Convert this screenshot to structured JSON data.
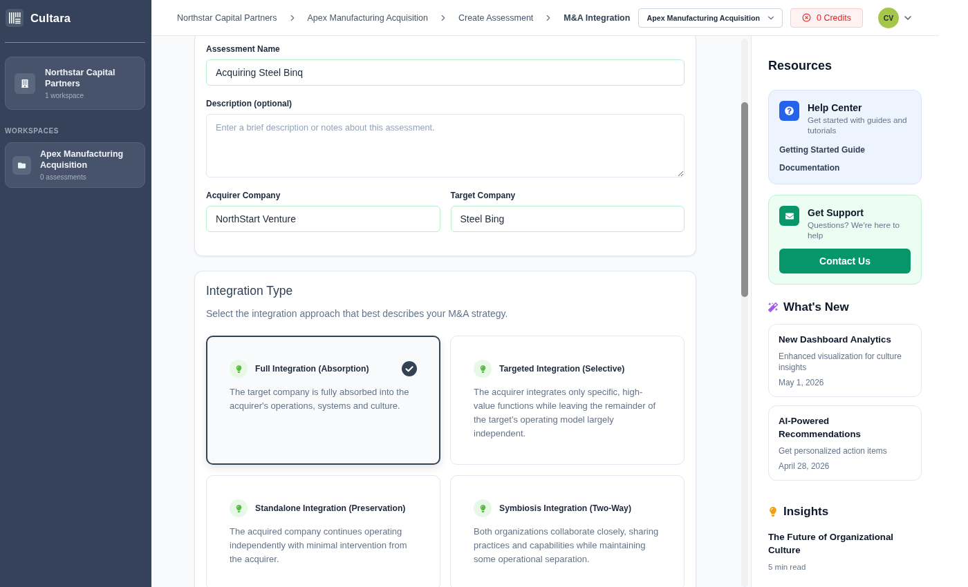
{
  "sidebar": {
    "brand": "Cultara",
    "organization": {
      "name": "Northstar Capital Partners",
      "meta": "1 workspace"
    },
    "section_label": "WORKSPACES",
    "workspaces": [
      {
        "name": "Apex Manufacturing Acquisition",
        "meta": "0 assessments"
      }
    ]
  },
  "header": {
    "breadcrumbs": [
      {
        "label": "Northstar Capital Partners",
        "current": false
      },
      {
        "label": "Apex Manufacturing Acquisition",
        "current": false
      },
      {
        "label": "Create Assessment",
        "current": false
      },
      {
        "label": "M&A Integration",
        "current": true
      }
    ],
    "workspace_select": {
      "value": "Apex Manufacturing Acquisition"
    },
    "credits": {
      "label": "0 Credits"
    },
    "avatar": {
      "initials": "CV"
    }
  },
  "details": {
    "assessment_name": {
      "label": "Assessment Name",
      "value": "Acquiring Steel Binq",
      "valid": true
    },
    "description": {
      "label": "Description (optional)",
      "placeholder": "Enter a brief description or notes about this assessment."
    },
    "companies": [
      {
        "label": "Acquirer Company",
        "value": "NorthStart Venture",
        "valid": true
      },
      {
        "label": "Target Company",
        "value": "Steel Bing",
        "valid": true
      }
    ]
  },
  "integration": {
    "title": "Integration Type",
    "subtitle": "Select the integration approach that best describes your M&A strategy.",
    "options": [
      {
        "title": "Full Integration (Absorption)",
        "description": "The target company is fully absorbed into the acquirer's operations, systems and culture.",
        "selected": true
      },
      {
        "title": "Targeted Integration (Selective)",
        "description": "The acquirer integrates only specific, high-value functions while leaving the remainder of the target's operating model largely independent.",
        "selected": false
      },
      {
        "title": "Standalone Integration (Preservation)",
        "description": "The acquired company continues operating independently with minimal intervention from the acquirer.",
        "selected": false
      },
      {
        "title": "Symbiosis Integration (Two-Way)",
        "description": "Both organizations collaborate closely, sharing practices and capabilities while maintaining some operational separation.",
        "selected": false
      }
    ]
  },
  "resources": {
    "title": "Resources",
    "help_center": {
      "title": "Help Center",
      "subtitle": "Get started with guides and tutorials",
      "links": [
        "Getting Started Guide",
        "Documentation"
      ]
    },
    "support": {
      "title": "Get Support",
      "subtitle": "Questions? We're here to help",
      "button": "Contact Us"
    }
  },
  "whats_new": {
    "title": "What's New",
    "items": [
      {
        "title": "New Dashboard Analytics",
        "description": "Enhanced visualization for culture insights",
        "date": "May 1, 2026"
      },
      {
        "title": "AI-Powered Recommendations",
        "description": "Get personalized action items",
        "date": "April 28, 2026"
      }
    ]
  },
  "insights": {
    "title": "Insights",
    "articles": [
      {
        "title": "The Future of Organizational Culture",
        "meta": "5 min read"
      }
    ]
  }
}
